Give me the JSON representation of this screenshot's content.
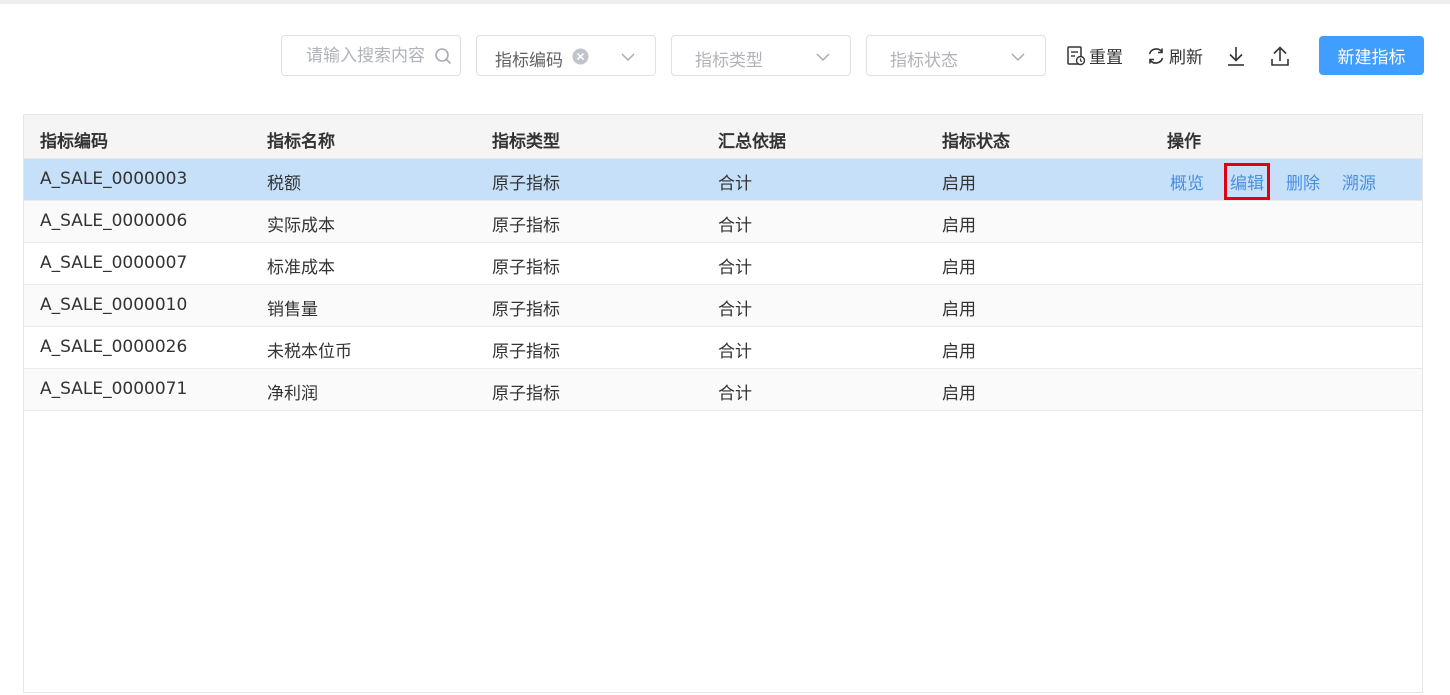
{
  "search": {
    "placeholder": "请输入搜索内容"
  },
  "filters": {
    "code": {
      "value": "指标编码"
    },
    "type": {
      "placeholder": "指标类型"
    },
    "status": {
      "placeholder": "指标状态"
    }
  },
  "toolbar": {
    "reset_label": "重置",
    "refresh_label": "刷新",
    "new_label": "新建指标"
  },
  "table": {
    "headers": [
      "指标编码",
      "指标名称",
      "指标类型",
      "汇总依据",
      "指标状态",
      "操作"
    ],
    "actions": [
      "概览",
      "编辑",
      "删除",
      "溯源"
    ],
    "rows": [
      [
        "A_SALE_0000003",
        "税额",
        "原子指标",
        "合计",
        "启用"
      ],
      [
        "A_SALE_0000006",
        "实际成本",
        "原子指标",
        "合计",
        "启用"
      ],
      [
        "A_SALE_0000007",
        "标准成本",
        "原子指标",
        "合计",
        "启用"
      ],
      [
        "A_SALE_0000010",
        "销售量",
        "原子指标",
        "合计",
        "启用"
      ],
      [
        "A_SALE_0000026",
        "未税本位币",
        "原子指标",
        "合计",
        "启用"
      ],
      [
        "A_SALE_0000071",
        "净利润",
        "原子指标",
        "合计",
        "启用"
      ]
    ]
  },
  "colors": {
    "primary": "#409eff",
    "selected_row": "#c6e0f9",
    "link": "#4a8fe0",
    "highlight": "#e00010"
  }
}
